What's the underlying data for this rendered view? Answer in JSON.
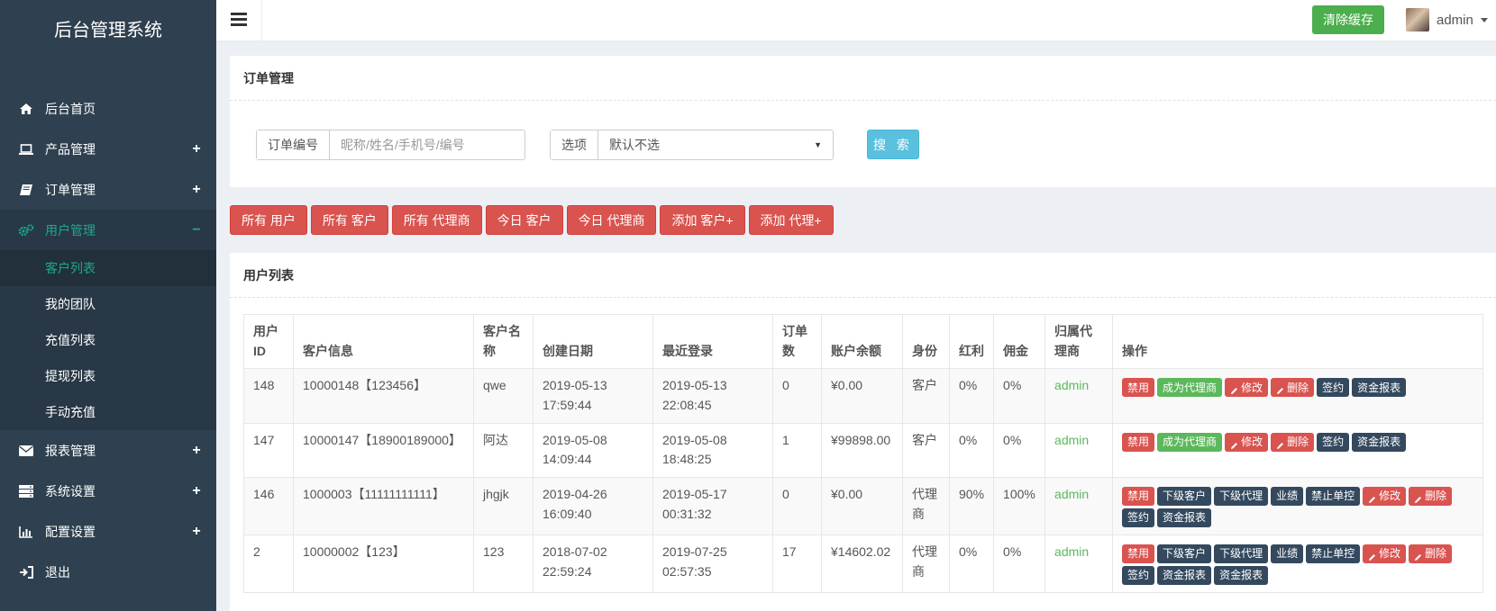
{
  "sidebar": {
    "brand": "后台管理系统",
    "items": [
      {
        "label": "后台首页",
        "icon": "home-icon"
      },
      {
        "label": "产品管理",
        "icon": "laptop-icon",
        "sign": "+"
      },
      {
        "label": "订单管理",
        "icon": "book-icon",
        "sign": "+"
      },
      {
        "label": "用户管理",
        "icon": "gears-icon",
        "sign": "−"
      },
      {
        "label": "报表管理",
        "icon": "envelope-icon",
        "sign": "+"
      },
      {
        "label": "系统设置",
        "icon": "server-icon",
        "sign": "+"
      },
      {
        "label": "配置设置",
        "icon": "bar-chart-icon",
        "sign": "+"
      },
      {
        "label": "退出",
        "icon": "sign-out-icon"
      }
    ],
    "sub_items": [
      "客户列表",
      "我的团队",
      "充值列表",
      "提现列表",
      "手动充值"
    ]
  },
  "topbar": {
    "clear_cache": "清除缓存",
    "username": "admin"
  },
  "search": {
    "title": "订单管理",
    "order_label": "订单编号",
    "order_placeholder": "昵称/姓名/手机号/编号",
    "option_label": "选项",
    "option_value": "默认不选",
    "search_btn": "搜 索"
  },
  "filters": [
    "所有 用户",
    "所有 客户",
    "所有 代理商",
    "今日 客户",
    "今日 代理商",
    "添加 客户+",
    "添加 代理+"
  ],
  "list": {
    "title": "用户列表",
    "headers": [
      "用户\nID",
      "客户信息",
      "客户名\n称",
      "创建日期",
      "最近登录",
      "订单\n数",
      "账户余额",
      "身份",
      "红利",
      "佣金",
      "归属代\n理商",
      "操作"
    ],
    "rows": [
      {
        "id": "148",
        "info": "10000148【123456】",
        "name": "qwe",
        "created": "2019-05-13\n17:59:44",
        "login": "2019-05-13\n22:08:45",
        "orders": "0",
        "balance": "¥0.00",
        "role": "客户",
        "bonus": "0%",
        "commission": "0%",
        "agent": "admin",
        "ops": [
          [
            "禁用",
            "red"
          ],
          [
            "成为代理商",
            "green"
          ],
          [
            "修改",
            "red",
            "pen"
          ],
          [
            "删除",
            "red",
            "pen"
          ],
          [
            "签约",
            "dark"
          ],
          [
            "资金报表",
            "dark"
          ]
        ]
      },
      {
        "id": "147",
        "info": "10000147【18900189000】",
        "name": "阿达",
        "created": "2019-05-08\n14:09:44",
        "login": "2019-05-08\n18:48:25",
        "orders": "1",
        "balance": "¥99898.00",
        "role": "客户",
        "bonus": "0%",
        "commission": "0%",
        "agent": "admin",
        "ops": [
          [
            "禁用",
            "red"
          ],
          [
            "成为代理商",
            "green"
          ],
          [
            "修改",
            "red",
            "pen"
          ],
          [
            "删除",
            "red",
            "pen"
          ],
          [
            "签约",
            "dark"
          ],
          [
            "资金报表",
            "dark"
          ]
        ]
      },
      {
        "id": "146",
        "info": "1000003【11111111111】",
        "name": "jhgjk",
        "created": "2019-04-26\n16:09:40",
        "login": "2019-05-17\n00:31:32",
        "orders": "0",
        "balance": "¥0.00",
        "role": "代理\n商",
        "bonus": "90%",
        "commission": "100%",
        "agent": "admin",
        "ops": [
          [
            "禁用",
            "red"
          ],
          [
            "下级客户",
            "dark"
          ],
          [
            "下级代理",
            "dark"
          ],
          [
            "业绩",
            "dark"
          ],
          [
            "禁止单控",
            "dark"
          ],
          [
            "修改",
            "red",
            "pen"
          ],
          [
            "删除",
            "red",
            "pen"
          ],
          [
            "签约",
            "dark"
          ],
          [
            "资金报表",
            "dark"
          ]
        ]
      },
      {
        "id": "2",
        "info": "10000002【123】",
        "name": "123",
        "created": "2018-07-02\n22:59:24",
        "login": "2019-07-25\n02:57:35",
        "orders": "17",
        "balance": "¥14602.02",
        "role": "代理\n商",
        "bonus": "0%",
        "commission": "0%",
        "agent": "admin",
        "ops": [
          [
            "禁用",
            "red"
          ],
          [
            "下级客户",
            "dark"
          ],
          [
            "下级代理",
            "dark"
          ],
          [
            "业绩",
            "dark"
          ],
          [
            "禁止单控",
            "dark"
          ],
          [
            "修改",
            "red",
            "pen"
          ],
          [
            "删除",
            "red",
            "pen"
          ],
          [
            "签约",
            "dark"
          ],
          [
            "资金报表",
            "dark"
          ],
          [
            "资金报表",
            "dark"
          ]
        ]
      }
    ]
  },
  "colors": {
    "sidebar_bg": "#2f4050",
    "active_text": "#19aa8d",
    "danger": "#d9534f",
    "success": "#5cb85c",
    "info": "#5bc0de",
    "dark": "#34495e"
  }
}
